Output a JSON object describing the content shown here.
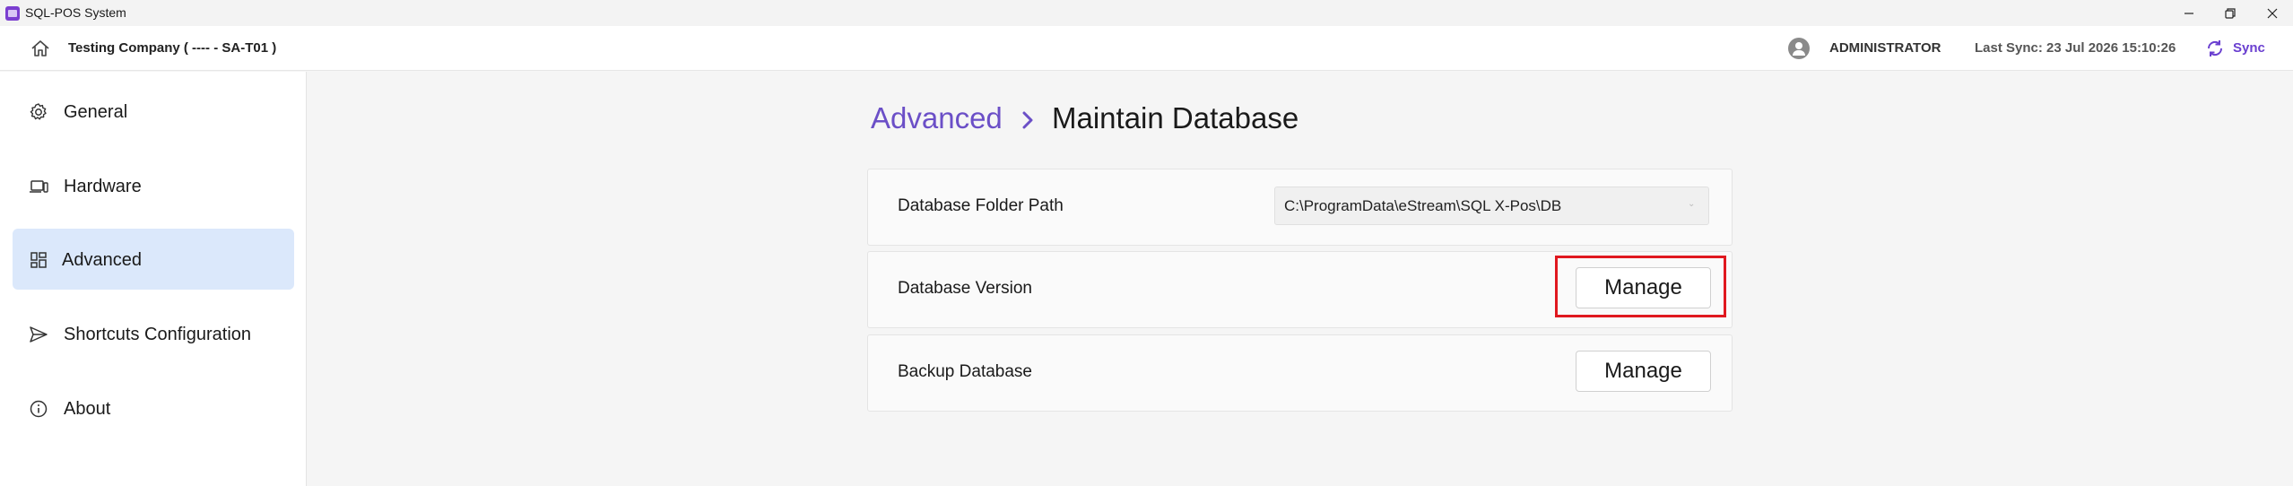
{
  "window": {
    "title": "SQL-POS System",
    "controls": [
      "minimize",
      "restore",
      "close"
    ]
  },
  "header": {
    "company": "Testing Company ( ---- - SA-T01 )",
    "user": "ADMINISTRATOR",
    "last_sync": "Last Sync: 23 Jul 2026 15:10:26",
    "sync_label": "Sync",
    "accent_color": "#6a3fd0"
  },
  "sidebar": {
    "items": [
      {
        "label": "General",
        "icon": "gear-icon",
        "active": false
      },
      {
        "label": "Hardware",
        "icon": "laptop-icon",
        "active": false
      },
      {
        "label": "Advanced",
        "icon": "dashboard-icon",
        "active": true
      },
      {
        "label": "Shortcuts Configuration",
        "icon": "send-icon",
        "active": false
      },
      {
        "label": "About",
        "icon": "info-icon",
        "active": false
      }
    ]
  },
  "breadcrumb": {
    "parent": "Advanced",
    "current": "Maintain Database"
  },
  "settings": {
    "folder_path_label": "Database Folder Path",
    "folder_path_value": "C:\\ProgramData\\eStream\\SQL X-Pos\\DB",
    "version_label": "Database Version",
    "version_button": "Manage",
    "backup_label": "Backup Database",
    "backup_button": "Manage"
  }
}
